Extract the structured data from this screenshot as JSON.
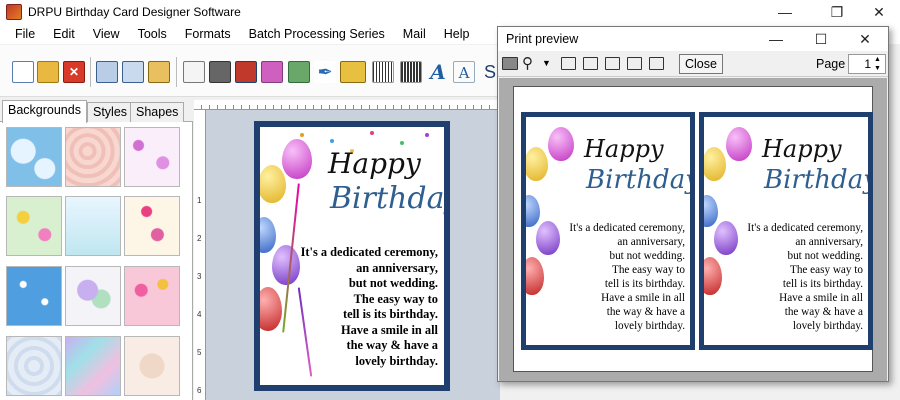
{
  "window": {
    "title": "DRPU Birthday Card Designer Software",
    "minimize": "—",
    "restore": "❐",
    "close": "✕"
  },
  "menu": [
    "File",
    "Edit",
    "View",
    "Tools",
    "Formats",
    "Batch Processing Series",
    "Mail",
    "Help"
  ],
  "toolbar": {
    "icons": [
      "new-icon",
      "open-icon",
      "close-file-icon",
      "save-icon",
      "save-as-icon",
      "export-icon",
      "properties-icon",
      "print-icon",
      "copy-icon",
      "gift-icon",
      "add-image-icon",
      "pen-icon",
      "picture-icon",
      "barcode-icon",
      "text-icon",
      "text-box-icon",
      "signature-icon"
    ]
  },
  "left_panel": {
    "tabs": [
      "Backgrounds",
      "Styles",
      "Shapes"
    ],
    "active_tab": "Backgrounds"
  },
  "ruler": {
    "left_numbers": [
      "1",
      "2",
      "3",
      "4",
      "5",
      "6"
    ]
  },
  "card": {
    "happy": "Happy",
    "birthday": "Birthday",
    "message": [
      "It's a dedicated ceremony,",
      "an anniversary,",
      "but not wedding.",
      "The easy way to",
      "tell is its  birthday.",
      "Have a smile in all",
      "the way & have a",
      "lovely birthday."
    ],
    "border_color": "#1f3f6e",
    "birthday_color": "#2f5f8f"
  },
  "print_preview": {
    "title": "Print preview",
    "close_label": "Close",
    "page_label": "Page",
    "page_value": "1",
    "minimize": "—",
    "maximize": "☐",
    "close_x": "✕"
  }
}
